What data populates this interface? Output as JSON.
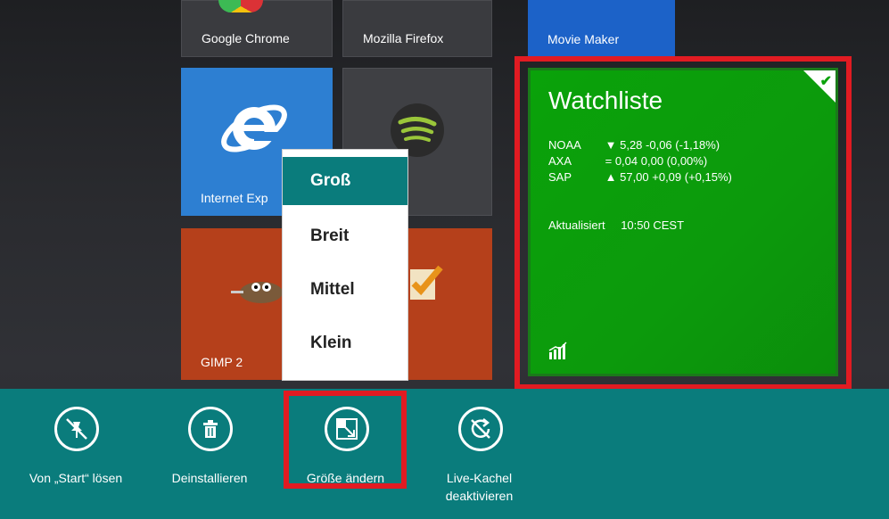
{
  "tiles": {
    "chrome": "Google Chrome",
    "firefox": "Mozilla Firefox",
    "movie_maker": "Movie Maker",
    "ie": "Internet Exp",
    "gimp": "GIMP 2"
  },
  "watchlist": {
    "title": "Watchliste",
    "rows": [
      {
        "symbol": "NOAA",
        "value": "▼ 5,28  -0,06 (-1,18%)"
      },
      {
        "symbol": "AXA",
        "value": "=  0,04  0,00 (0,00%)"
      },
      {
        "symbol": "SAP",
        "value": "▲ 57,00  +0,09 (+0,15%)"
      }
    ],
    "updated_label": "Aktualisiert",
    "updated_time": "10:50 CEST"
  },
  "size_menu": {
    "items": [
      "Groß",
      "Breit",
      "Mittel",
      "Klein"
    ],
    "selected": "Groß"
  },
  "app_bar": {
    "unpin": "Von „Start“ lösen",
    "uninstall": "Deinstallieren",
    "resize": "Größe ändern",
    "live_tile_line1": "Live-Kachel",
    "live_tile_line2": "deaktivieren"
  },
  "colors": {
    "accent": "#0a7c7c",
    "highlight_red": "#e11b22",
    "watch_green": "#0aa20a"
  }
}
